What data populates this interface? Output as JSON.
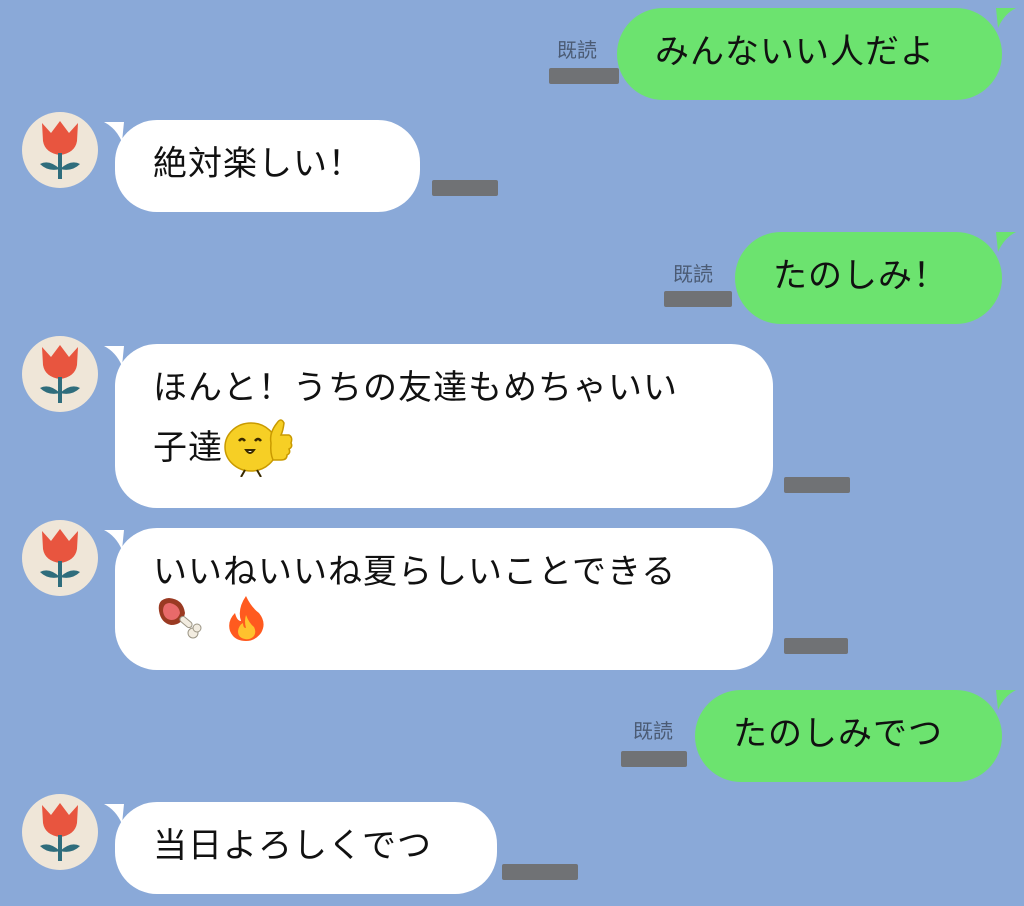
{
  "conversation": {
    "read_label": "既読",
    "messages": [
      {
        "from": "me",
        "text": "みんないい人だよ",
        "read": "既読"
      },
      {
        "from": "friend",
        "text": "絶対楽しい！"
      },
      {
        "from": "me",
        "text": "たのしみ！",
        "read": "既読"
      },
      {
        "from": "friend",
        "line1": "ほんと！うちの友達もめちゃいい",
        "line2": "子達",
        "sticker": "thumbs-up-chick-icon"
      },
      {
        "from": "friend",
        "text": "いいねいいね夏らしいことできる",
        "emojis": [
          "meat-on-bone-icon",
          "fire-icon"
        ]
      },
      {
        "from": "me",
        "text": "たのしみでつ",
        "read": "既読"
      },
      {
        "from": "friend",
        "text": "当日よろしくでつ"
      }
    ]
  },
  "colors": {
    "background": "#8aa9d8",
    "outgoing_bubble": "#6ce36f",
    "incoming_bubble": "#ffffff",
    "avatar_bg": "#efe6d8",
    "tulip_red": "#e8553f",
    "tulip_stem": "#2f6d7c"
  },
  "avatar": {
    "icon": "tulip-icon"
  }
}
